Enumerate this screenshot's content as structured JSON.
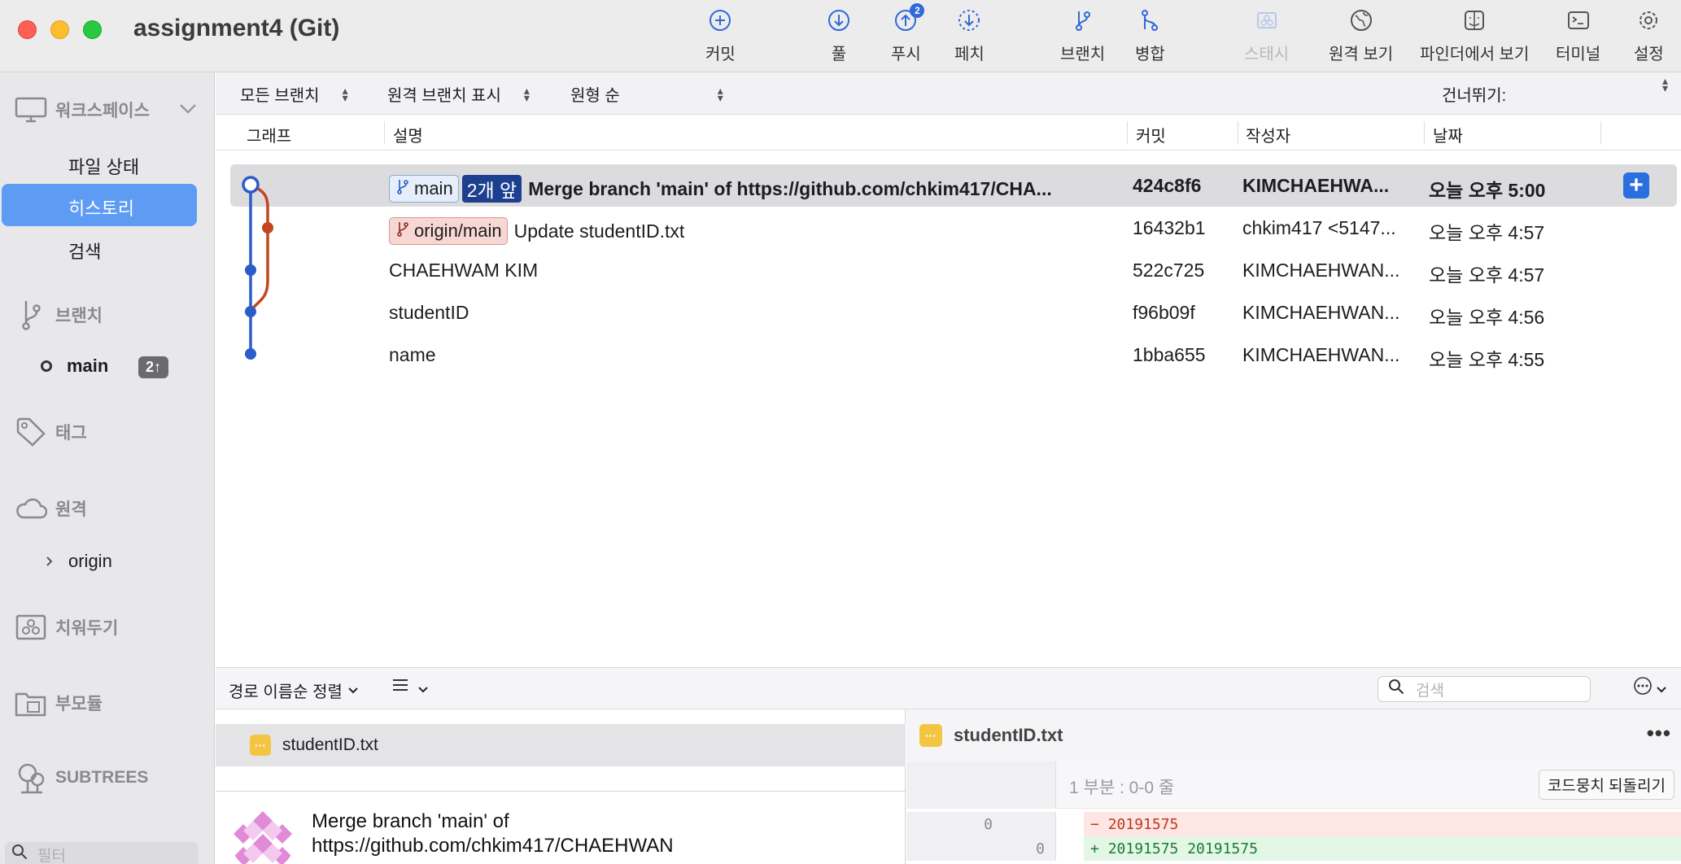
{
  "window": {
    "title": "assignment4 (Git)"
  },
  "toolbar": {
    "commit": "커밋",
    "pull": "풀",
    "push": "푸시",
    "push_badge": "2",
    "fetch": "페치",
    "branch": "브랜치",
    "merge": "병합",
    "stash": "스태시",
    "remote_view": "원격 보기",
    "finder_view": "파인더에서 보기",
    "terminal": "터미널",
    "settings": "설정"
  },
  "sidebar": {
    "workspace": "워크스페이스",
    "file_status": "파일 상태",
    "history": "히스토리",
    "search": "검색",
    "branches": "브랜치",
    "branch_main": "main",
    "branch_main_ahead": "2↑",
    "tags": "태그",
    "remotes": "원격",
    "remote_origin": "origin",
    "stashes": "치워두기",
    "submodules": "부모듈",
    "subtrees": "SUBTREES",
    "filter_placeholder": "필터"
  },
  "filterbar": {
    "branches": "모든 브랜치",
    "show_remote": "원격 브랜치 표시",
    "order": "원형 순",
    "jump_to": "건너뛰기:"
  },
  "columns": {
    "graph": "그래프",
    "description": "설명",
    "commit": "커밋",
    "author": "작성자",
    "date": "날짜"
  },
  "commits": [
    {
      "branch_tag": "main",
      "ahead_tag": "2개 앞",
      "message": "Merge branch 'main' of https://github.com/chkim417/CHA...",
      "hash": "424c8f6",
      "author": "KIMCHAEHWA...",
      "date": "오늘 오후 5:00"
    },
    {
      "remote_tag": "origin/main",
      "message": "Update studentID.txt",
      "hash": "16432b1",
      "author": "chkim417 <5147...",
      "date": "오늘 오후 4:57"
    },
    {
      "message": "CHAEHWAM KIM",
      "hash": "522c725",
      "author": "KIMCHAEHWAN...",
      "date": "오늘 오후 4:57"
    },
    {
      "message": "studentID",
      "hash": "f96b09f",
      "author": "KIMCHAEHWAN...",
      "date": "오늘 오후 4:56"
    },
    {
      "message": "name",
      "hash": "1bba655",
      "author": "KIMCHAEHWAN...",
      "date": "오늘 오후 4:55"
    }
  ],
  "bottombar": {
    "sort": "경로 이름순 정렬",
    "search_placeholder": "검색"
  },
  "files": [
    {
      "name": "studentID.txt"
    }
  ],
  "commit_detail": {
    "message_line1": "Merge branch 'main' of",
    "message_line2": "https://github.com/chkim417/CHAEHWAN"
  },
  "diff": {
    "file": "studentID.txt",
    "hunk_header": "1 부분 : 0-0 줄",
    "revert_label": "코드뭉치 되돌리기",
    "lines": [
      {
        "type": "del",
        "old": "0",
        "new": "",
        "sign": "−",
        "text": "20191575"
      },
      {
        "type": "add",
        "old": "",
        "new": "0",
        "sign": "+",
        "text": "20191575 20191575"
      }
    ]
  },
  "colors": {
    "accent": "#2a6fe0",
    "selection": "#5e9cf3",
    "graph_main": "#2b5cc7",
    "graph_remote": "#c4461f"
  }
}
